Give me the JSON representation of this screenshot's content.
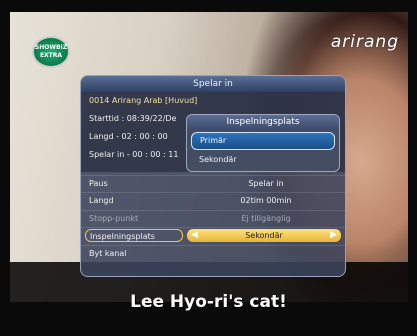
{
  "overlay": {
    "channel_logo": "arirang",
    "badge": "SHOWBIZ EXTRA",
    "subtitle": "Lee Hyo-ri's cat!"
  },
  "record_panel": {
    "title": "Spelar in",
    "channel": "0014  Arirang Arab [Huvud]",
    "start_time": "Starttid : 08:39/22/De",
    "length": "Langd - 02 : 00 : 00",
    "recording_elapsed": "Spelar in - 00 : 00 : 11",
    "rows": [
      {
        "key": "Paus",
        "value": "Spelar in"
      },
      {
        "key": "Langd",
        "value": "02tim 00min"
      },
      {
        "key": "Stopp-punkt",
        "value": "Ej tillgänglig"
      },
      {
        "key": "Inspelningsplats",
        "value": "Sekondär"
      },
      {
        "key": "Byt kanal",
        "value": ""
      }
    ]
  },
  "location_popup": {
    "title": "Inspelningsplats",
    "options": [
      "Primär",
      "Sekondär"
    ],
    "selected_index": 0
  },
  "colors": {
    "panel_bg": "#3c445c",
    "highlight_yellow": "#f2c54a",
    "selection_blue": "#2c73b8"
  }
}
